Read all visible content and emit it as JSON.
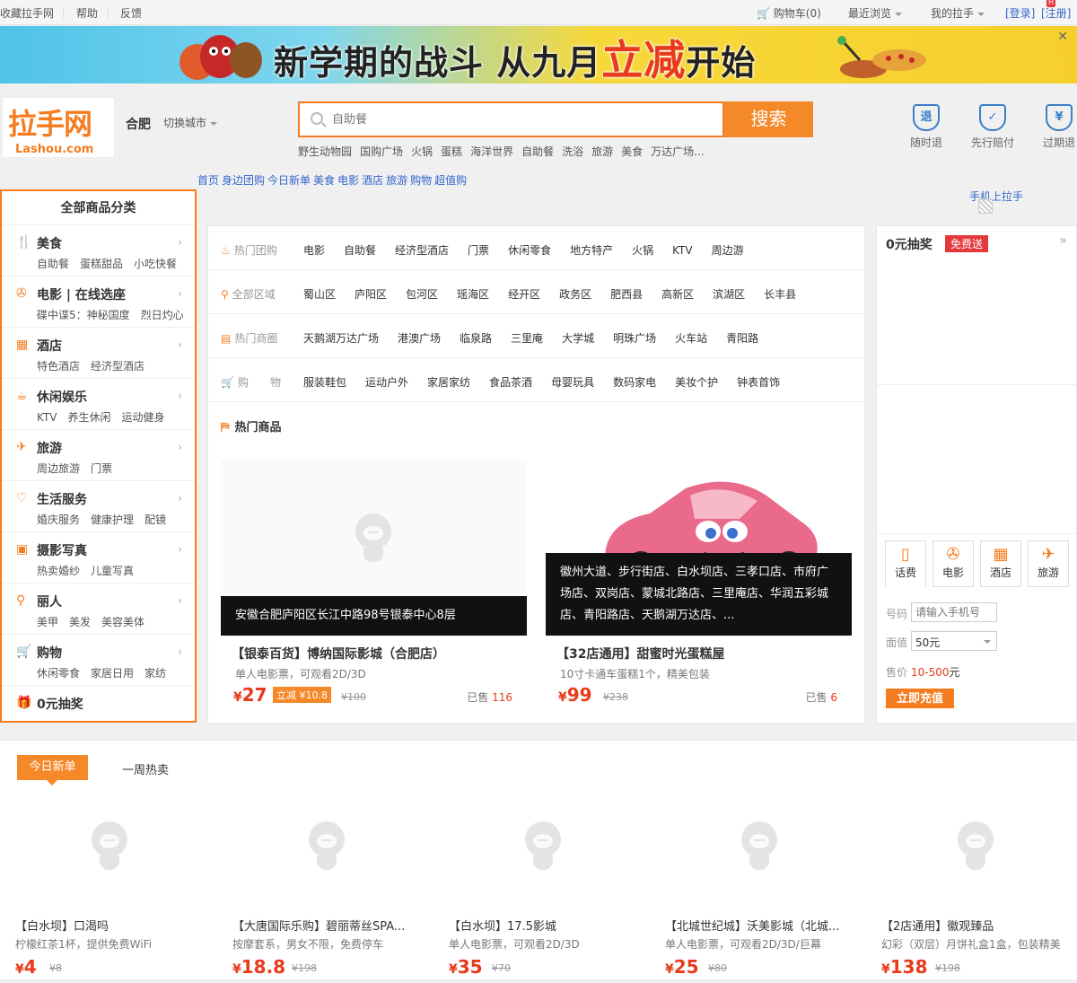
{
  "topbar": {
    "left": [
      "收藏拉手网",
      "帮助",
      "反馈"
    ],
    "cart": "购物车(0)",
    "recent": "最近浏览",
    "mine": "我的拉手",
    "login": "[登录]",
    "register": "[注册]"
  },
  "banner": {
    "title_a": "新学期的战斗 从九月",
    "title_b": "立减",
    "title_c": "开始"
  },
  "logo": {
    "cn": "拉手网",
    "en": "Lashou.com"
  },
  "city": {
    "name": "合肥",
    "switch": "切换城市"
  },
  "search": {
    "placeholder": "自助餐",
    "button": "搜索",
    "hotwords": [
      "野生动物园",
      "国购广场",
      "火锅",
      "蛋糕",
      "海洋世界",
      "自助餐",
      "洗浴",
      "旅游",
      "美食",
      "万达广场..."
    ]
  },
  "guarantees": [
    {
      "icon": "退",
      "label": "随时退"
    },
    {
      "icon": "✓",
      "label": "先行赔付"
    },
    {
      "icon": "¥",
      "label": "过期退"
    }
  ],
  "nav": [
    "首页",
    "身边团购",
    "今日新单",
    "美食",
    "电影",
    "酒店",
    "旅游",
    "购物",
    "超值购"
  ],
  "mobile": "手机上拉手",
  "category": {
    "title": "全部商品分类",
    "items": [
      {
        "icon": "fork-knife-icon",
        "name": "美食",
        "subs": [
          "自助餐",
          "蛋糕甜品",
          "小吃快餐"
        ]
      },
      {
        "icon": "film-reel-icon",
        "name": "电影 | 在线选座",
        "subs": [
          "碟中谍5：神秘国度",
          "烈日灼心"
        ]
      },
      {
        "icon": "hotel-icon",
        "name": "酒店",
        "subs": [
          "特色酒店",
          "经济型酒店"
        ]
      },
      {
        "icon": "coffee-cup-icon",
        "name": "休闲娱乐",
        "subs": [
          "KTV",
          "养生休闲",
          "运动健身"
        ]
      },
      {
        "icon": "plane-icon",
        "name": "旅游",
        "subs": [
          "周边旅游",
          "门票"
        ]
      },
      {
        "icon": "heart-icon",
        "name": "生活服务",
        "subs": [
          "婚庆服务",
          "健康护理",
          "配镜"
        ]
      },
      {
        "icon": "photo-icon",
        "name": "摄影写真",
        "subs": [
          "热卖婚纱",
          "儿童写真"
        ]
      },
      {
        "icon": "beauty-icon",
        "name": "丽人",
        "subs": [
          "美甲",
          "美发",
          "美容美体"
        ]
      },
      {
        "icon": "cart-icon",
        "name": "购物",
        "subs": [
          "休闲零食",
          "家居日用",
          "家纺"
        ]
      }
    ],
    "lottery": "0元抽奖"
  },
  "filters": [
    {
      "label": "热门团购",
      "items": [
        "电影",
        "自助餐",
        "经济型酒店",
        "门票",
        "休闲零食",
        "地方特产",
        "火锅",
        "KTV",
        "周边游"
      ]
    },
    {
      "label": "全部区域",
      "items": [
        "蜀山区",
        "庐阳区",
        "包河区",
        "瑶海区",
        "经开区",
        "政务区",
        "肥西县",
        "高新区",
        "滨湖区",
        "长丰县"
      ]
    },
    {
      "label": "热门商圈",
      "items": [
        "天鹅湖万达广场",
        "港澳广场",
        "临泉路",
        "三里庵",
        "大学城",
        "明珠广场",
        "火车站",
        "青阳路"
      ]
    },
    {
      "label": "购　　物",
      "items": [
        "服装鞋包",
        "运动户外",
        "家居家纺",
        "食品茶酒",
        "母婴玩具",
        "数码家电",
        "美妆个护",
        "钟表首饰"
      ]
    }
  ],
  "hot_goods": {
    "title": "热门商品",
    "cards": [
      {
        "caption": "安徽合肥庐阳区长江中路98号银泰中心8层",
        "title": "【银泰百货】博纳国际影城（合肥店）",
        "desc": "单人电影票，可观看2D/3D",
        "price": "27",
        "tag": "立减 ¥10.8",
        "old": "¥100",
        "sold_label": "已售",
        "sold": "116"
      },
      {
        "caption": "徽州大道、步行街店、白水坝店、三孝口店、市府广场店、双岗店、蒙城北路店、三里庵店、华润五彩城店、青阳路店、天鹅湖万达店、...",
        "title": "【32店通用】甜蜜时光蛋糕屋",
        "desc": "10寸卡通车蛋糕1个，精美包装",
        "price": "99",
        "tag": "",
        "old": "¥238",
        "sold_label": "已售",
        "sold": "6"
      }
    ]
  },
  "right": {
    "lottery": "0元抽奖",
    "free": "免费送",
    "tabs": [
      "话费",
      "电影",
      "酒店",
      "旅游"
    ],
    "phone_label": "号码",
    "phone_placeholder": "请输入手机号",
    "amount_label": "面值",
    "amount_value": "50元",
    "price_label": "售价",
    "price_range": "10-500",
    "price_unit": "元",
    "charge": "立即充值"
  },
  "bottom": {
    "tab_new": "今日新单",
    "tab_week": "一周热卖",
    "items": [
      {
        "title": "【白水坝】口渴吗",
        "desc": "柠檬红茶1杯，提供免费WiFi",
        "price": "4",
        "old": "¥8"
      },
      {
        "title": "【大唐国际乐购】碧丽蒂丝SPA...",
        "desc": "按摩套系，男女不限，免费停车",
        "price": "18.8",
        "old": "¥198"
      },
      {
        "title": "【白水坝】17.5影城",
        "desc": "单人电影票，可观看2D/3D",
        "price": "35",
        "old": "¥70"
      },
      {
        "title": "【北城世纪城】沃美影城（北城...",
        "desc": "单人电影票，可观看2D/3D/巨幕",
        "price": "25",
        "old": "¥80"
      },
      {
        "title": "【2店通用】徽观臻品",
        "desc": "幻彩（双层）月饼礼盒1盒，包装精美",
        "price": "138",
        "old": "¥198"
      }
    ]
  },
  "colors": {
    "accent": "#f57c1f",
    "price": "#e83a1c",
    "link": "#3366cc"
  }
}
